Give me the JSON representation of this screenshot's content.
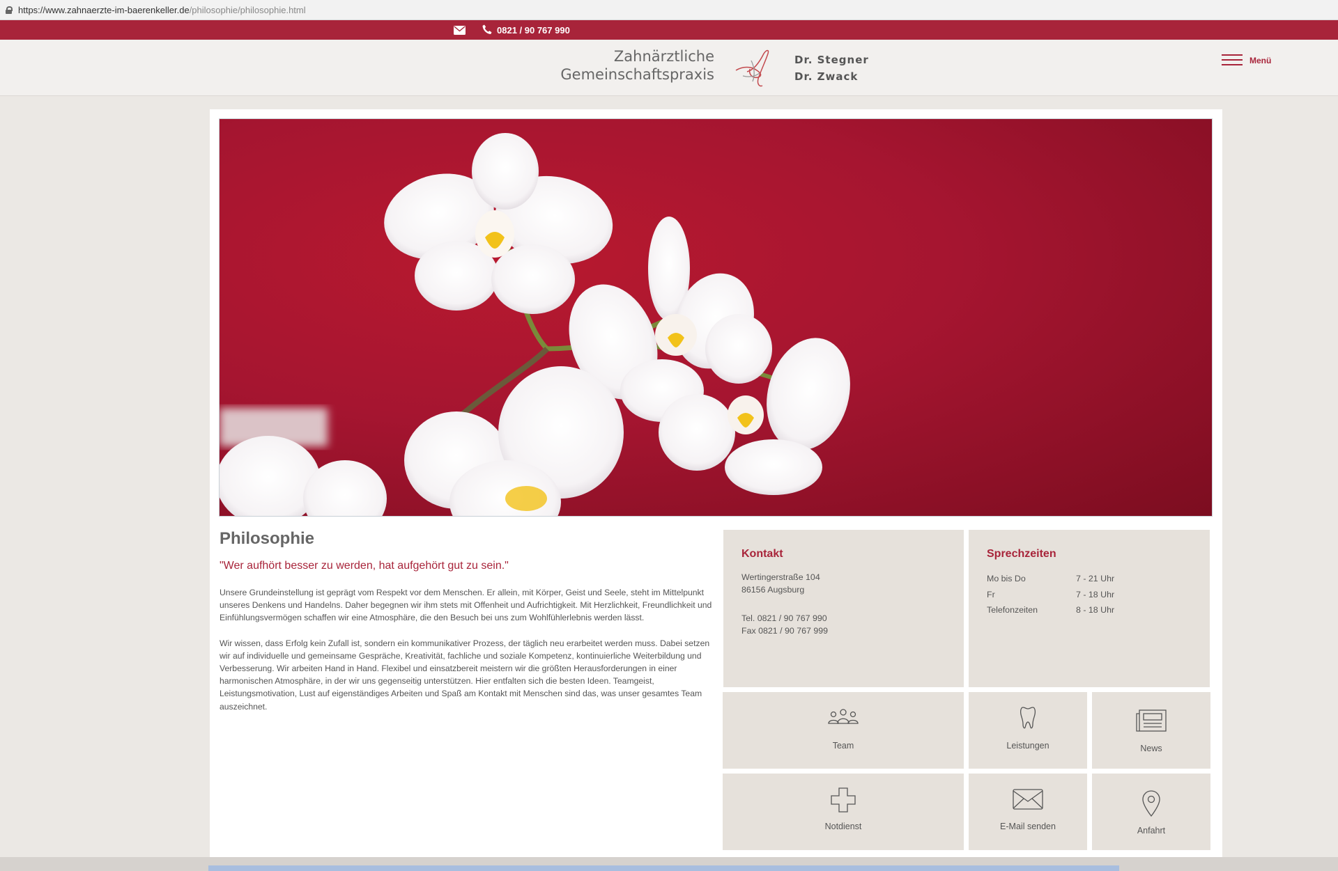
{
  "browser": {
    "url_host": "https://www.zahnaerzte-im-baerenkeller.de",
    "url_path": "/philosophie/philosophie.html"
  },
  "topbar": {
    "phone": "0821 / 90 767 990"
  },
  "header": {
    "logo_line1": "Zahnärztliche",
    "logo_line2": "Gemeinschaftspraxis",
    "doctor1": "Dr. Stegner",
    "doctor2": "Dr. Zwack",
    "menu_label": "Menü"
  },
  "main": {
    "title": "Philosophie",
    "quote": "\"Wer aufhört besser zu werden, hat aufgehört gut zu sein.\"",
    "paragraph1": "Unsere Grundeinstellung ist geprägt vom Respekt vor dem Menschen. Er allein, mit Körper, Geist und Seele, steht im Mittelpunkt unseres Denkens und Handelns. Daher begegnen wir ihm stets mit Offenheit und Aufrichtigkeit. Mit Herzlichkeit, Freundlichkeit und Einfühlungsvermögen schaffen wir eine Atmosphäre, die den Besuch bei uns zum Wohlfühlerlebnis werden lässt.",
    "paragraph2": "Wir wissen, dass Erfolg kein Zufall ist, sondern ein kommunikativer Prozess, der täglich neu erarbeitet werden muss. Dabei setzen wir auf individuelle und gemeinsame Gespräche, Kreativität, fachliche und soziale Kompetenz, kontinuierliche Weiterbildung und Verbesserung. Wir arbeiten Hand in Hand. Flexibel und einsatzbereit meistern wir die größten Herausforderungen in einer harmonischen Atmosphäre, in der wir uns gegenseitig unterstützen. Hier entfalten sich die besten Ideen. Teamgeist, Leistungsmotivation, Lust auf eigenständiges Arbeiten und Spaß am Kontakt mit Menschen sind das, was unser gesamtes Team auszeichnet."
  },
  "kontakt": {
    "title": "Kontakt",
    "street": "Wertingerstraße 104",
    "city": "86156 Augsburg",
    "tel": "Tel. 0821 / 90 767 990",
    "fax": "Fax 0821 / 90 767 999"
  },
  "sprechzeiten": {
    "title": "Sprechzeiten",
    "rows": [
      {
        "day": "Mo bis Do",
        "time": "7 - 21 Uhr"
      },
      {
        "day": "Fr",
        "time": "7 - 18 Uhr"
      },
      {
        "day": "Telefonzeiten",
        "time": "8 - 18 Uhr"
      }
    ]
  },
  "tiles": {
    "team": "Team",
    "leistungen": "Leistungen",
    "news": "News",
    "notdienst": "Notdienst",
    "email": "E-Mail senden",
    "anfahrt": "Anfahrt"
  },
  "icons": {
    "mail": "envelope-icon",
    "phone": "phone-icon",
    "menu": "hamburger-icon",
    "team": "people-icon",
    "leistungen": "tooth-icon",
    "news": "newspaper-icon",
    "notdienst": "cross-icon",
    "email": "envelope-icon",
    "anfahrt": "map-pin-icon"
  },
  "colors": {
    "brand_red": "#a8243a",
    "box_bg": "#e6e1db",
    "page_bg": "#ebe8e4"
  }
}
